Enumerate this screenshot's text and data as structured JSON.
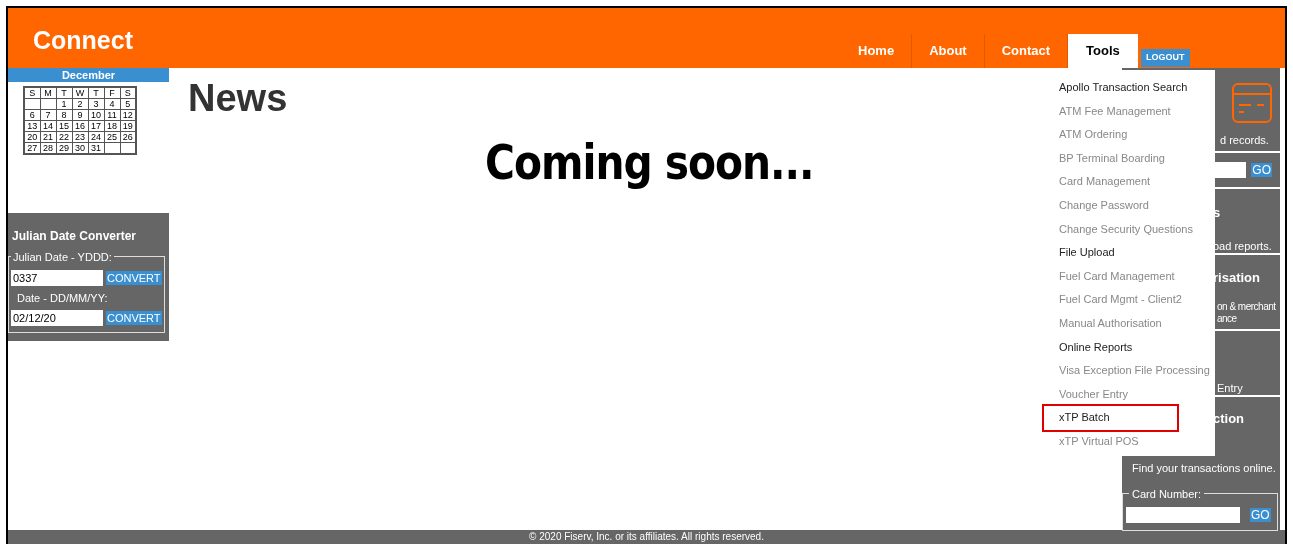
{
  "header": {
    "logo": "Connect",
    "tabs": [
      {
        "label": "Home",
        "selected": false
      },
      {
        "label": "About",
        "selected": false
      },
      {
        "label": "Contact",
        "selected": false
      },
      {
        "label": "Tools",
        "selected": true
      }
    ],
    "logout": "LOGOUT"
  },
  "calendar": {
    "month": "December",
    "weekdays": [
      "S",
      "M",
      "T",
      "W",
      "T",
      "F",
      "S"
    ],
    "weeks": [
      {
        "kind": "start",
        "days": [
          "1",
          "2",
          "3",
          "4",
          "5"
        ]
      },
      {
        "kind": "full",
        "days": [
          "6",
          "7",
          "8",
          "9",
          "10",
          "11",
          "12"
        ]
      },
      {
        "kind": "full",
        "days": [
          "13",
          "14",
          "15",
          "16",
          "17",
          "18",
          "19"
        ]
      },
      {
        "kind": "full",
        "days": [
          "20",
          "21",
          "22",
          "23",
          "24",
          "25",
          "26"
        ]
      },
      {
        "kind": "end",
        "days": [
          "27",
          "28",
          "29",
          "30",
          "31"
        ]
      }
    ]
  },
  "julian_converter": {
    "title": "Julian Date Converter",
    "julian_label": "Julian Date - YDDD:",
    "julian_value": "0337",
    "julian_button": "CONVERT",
    "date_label": "Date - DD/MM/YY:",
    "date_value": "02/12/20",
    "date_button": "CONVERT"
  },
  "main": {
    "heading": "News",
    "message": "Coming soon..."
  },
  "tools_menu": [
    {
      "label": "Apollo Transaction Search",
      "disabled": false,
      "highlighted": false
    },
    {
      "label": "ATM Fee Management",
      "disabled": true,
      "highlighted": false
    },
    {
      "label": "ATM Ordering",
      "disabled": true,
      "highlighted": false
    },
    {
      "label": "BP Terminal Boarding",
      "disabled": true,
      "highlighted": false
    },
    {
      "label": "Card Management",
      "disabled": true,
      "highlighted": false
    },
    {
      "label": "Change Password",
      "disabled": true,
      "highlighted": false
    },
    {
      "label": "Change Security Questions",
      "disabled": true,
      "highlighted": false
    },
    {
      "label": "File Upload",
      "disabled": false,
      "highlighted": false
    },
    {
      "label": "Fuel Card Management",
      "disabled": true,
      "highlighted": false
    },
    {
      "label": "Fuel Card Mgmt - Client2",
      "disabled": true,
      "highlighted": false
    },
    {
      "label": "Manual Authorisation",
      "disabled": true,
      "highlighted": false
    },
    {
      "label": "Online Reports",
      "disabled": false,
      "highlighted": false
    },
    {
      "label": "Visa Exception File Processing",
      "disabled": true,
      "highlighted": false
    },
    {
      "label": "Voucher Entry",
      "disabled": true,
      "highlighted": false
    },
    {
      "label": "xTP Batch",
      "disabled": false,
      "highlighted": true
    },
    {
      "label": "xTP Virtual POS",
      "disabled": true,
      "highlighted": false
    }
  ],
  "right_panel": {
    "records_text": "d records.",
    "search_go": "GO",
    "reports_title": "s",
    "reports_text": "oad reports.",
    "auth_title": "risation",
    "auth_text": [
      "on & merchant",
      "ance"
    ],
    "voucher_text": "Entry",
    "transaction_title": "ction",
    "transaction_text": "Find your transactions online.",
    "card_label": "Card Number:",
    "card_go": "GO"
  },
  "footer": "© 2020 Fiserv, Inc. or its affiliates. All rights reserved."
}
